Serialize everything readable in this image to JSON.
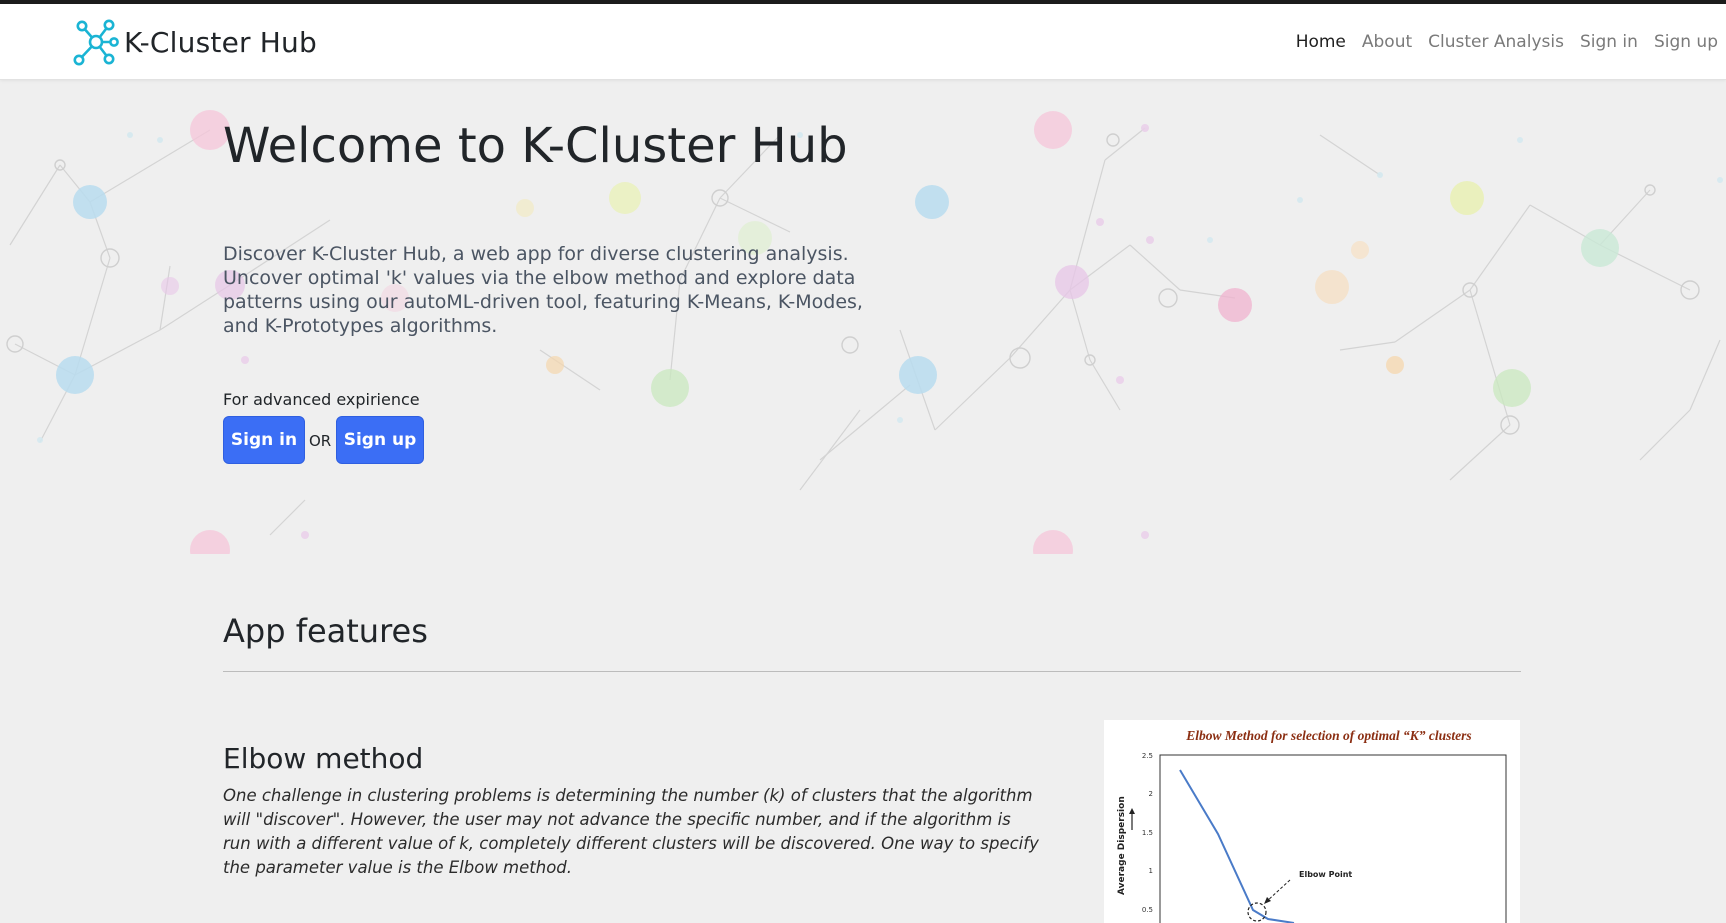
{
  "navbar": {
    "brand": "K-Cluster Hub",
    "links": [
      "Home",
      "About",
      "Cluster Analysis",
      "Sign in",
      "Sign up"
    ],
    "active": "Home"
  },
  "hero": {
    "title": "Welcome to K-Cluster Hub",
    "description": "Discover K-Cluster Hub, a web app for diverse clustering analysis. Uncover optimal 'k' values via the elbow method and explore data patterns using our autoML-driven tool, featuring K-Means, K-Modes, and K-Prototypes algorithms.",
    "advanced_label": "For advanced expirience",
    "signin_label": "Sign in",
    "or_label": "OR",
    "signup_label": "Sign up"
  },
  "features": {
    "title": "App features",
    "elbow": {
      "title": "Elbow method",
      "description": "One challenge in clustering problems is determining the number (k) of clusters that the algorithm will \"discover\". However, the user may not advance the specific number, and if the algorithm is run with a different value of k, completely different clusters will be discovered. One way to specify the parameter value is the Elbow method."
    },
    "figure": {
      "title": "Elbow Method for selection of optimal “K” clusters",
      "ylabel": "Average Dispersion",
      "annotation": "Elbow Point",
      "yticks": [
        "2.5",
        "2",
        "1.5",
        "1",
        "0.5"
      ]
    }
  },
  "colors": {
    "primary": "#3b6ef5",
    "brand_icon": "#1ab4d4",
    "figure_title": "#8b2e12"
  },
  "icons": {
    "brand": "cluster-network-icon"
  }
}
